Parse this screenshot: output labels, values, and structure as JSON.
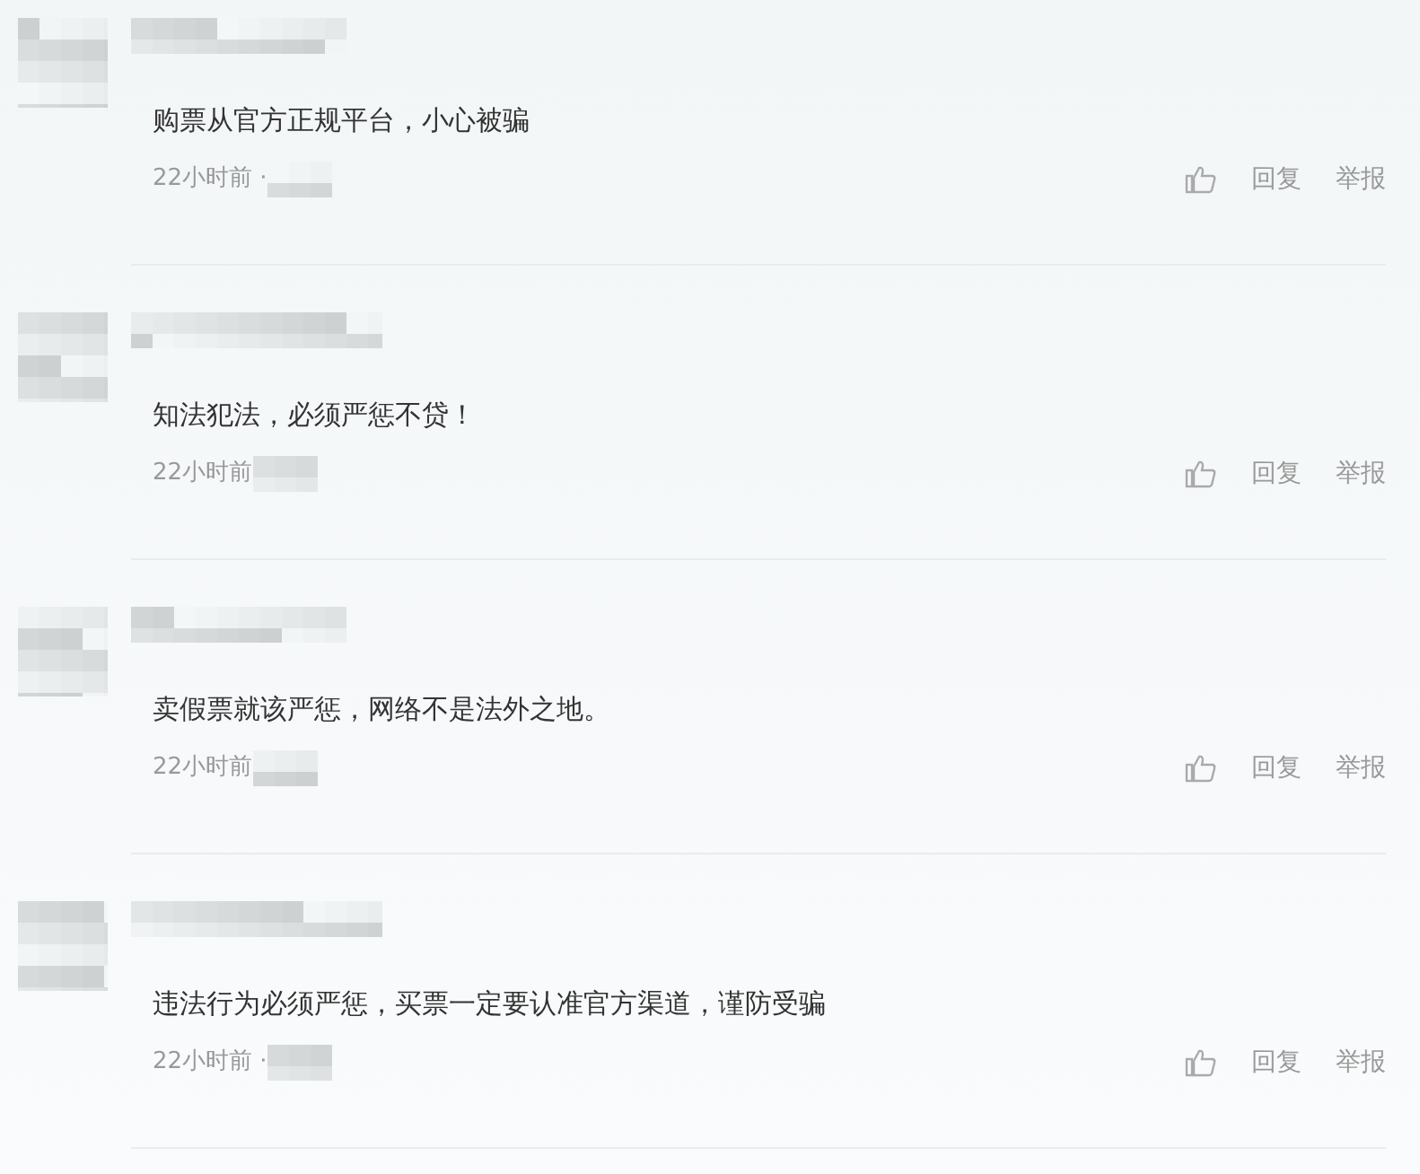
{
  "comments": [
    {
      "text": "购票从官方正规平台，小心被骗",
      "time": "22小时前 ·",
      "reply": "回复",
      "report": "举报"
    },
    {
      "text": "知法犯法，必须严惩不贷！",
      "time": "22小时前",
      "reply": "回复",
      "report": "举报"
    },
    {
      "text": "卖假票就该严惩，网络不是法外之地。",
      "time": "22小时前",
      "reply": "回复",
      "report": "举报"
    },
    {
      "text": "违法行为必须严惩，买票一定要认准官方渠道，谨防受骗",
      "time": "22小时前 ·",
      "reply": "回复",
      "report": "举报"
    }
  ]
}
